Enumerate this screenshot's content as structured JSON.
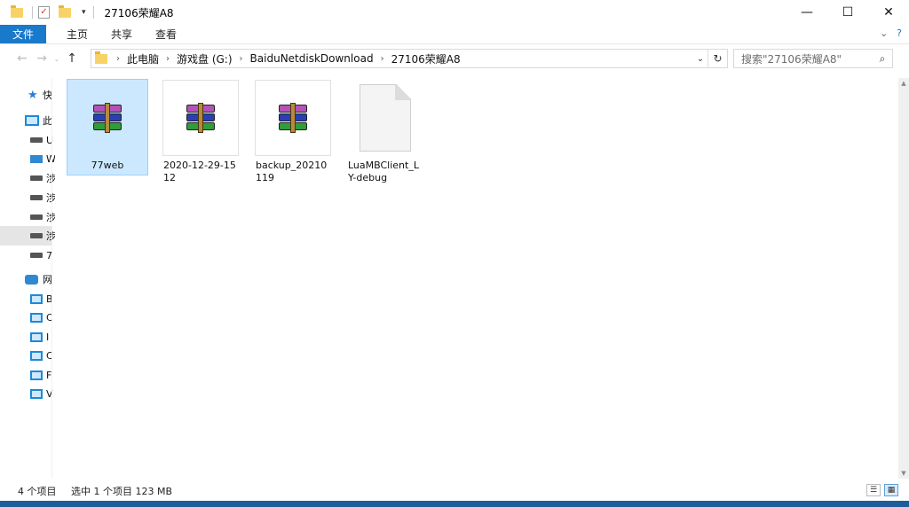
{
  "window": {
    "title": "27106荣耀A8",
    "minimize": "—",
    "maximize": "☐",
    "close": "✕"
  },
  "ribbon": {
    "tabs": [
      "文件",
      "主页",
      "共享",
      "查看"
    ],
    "expand": "⌄",
    "help": "?"
  },
  "address": {
    "crumbs": [
      "此电脑",
      "游戏盘 (G:)",
      "BaiduNetdiskDownload",
      "27106荣耀A8"
    ],
    "search_placeholder": "搜索\"27106荣耀A8\""
  },
  "nav_pane": {
    "items": [
      {
        "label": "快",
        "icon": "star-icon"
      },
      {
        "label": "此",
        "icon": "pc-icon"
      },
      {
        "label": "U",
        "icon": "drive-icon"
      },
      {
        "label": "W",
        "icon": "network-drive-icon"
      },
      {
        "label": "涉",
        "icon": "drive-icon"
      },
      {
        "label": "涉",
        "icon": "drive-icon"
      },
      {
        "label": "涉",
        "icon": "drive-icon"
      },
      {
        "label": "涉",
        "icon": "drive-icon"
      },
      {
        "label": "7",
        "icon": "drive-icon"
      },
      {
        "label": "网",
        "icon": "network-icon"
      },
      {
        "label": "B",
        "icon": "computer-icon"
      },
      {
        "label": "C",
        "icon": "computer-icon"
      },
      {
        "label": "I",
        "icon": "computer-icon"
      },
      {
        "label": "C",
        "icon": "computer-icon"
      },
      {
        "label": "F",
        "icon": "computer-icon"
      },
      {
        "label": "V",
        "icon": "computer-icon"
      }
    ]
  },
  "files": [
    {
      "name": "77web",
      "type": "rar",
      "selected": true
    },
    {
      "name": "2020-12-29-1512",
      "type": "rar",
      "selected": false
    },
    {
      "name": "backup_20210119",
      "type": "rar",
      "selected": false
    },
    {
      "name": "LuaMBClient_LY-debug",
      "type": "file",
      "selected": false
    }
  ],
  "status": {
    "item_count": "4 个项目",
    "selection": "选中 1 个项目  123 MB"
  },
  "colors": {
    "accent": "#1979ca",
    "selection": "#cce8ff"
  }
}
